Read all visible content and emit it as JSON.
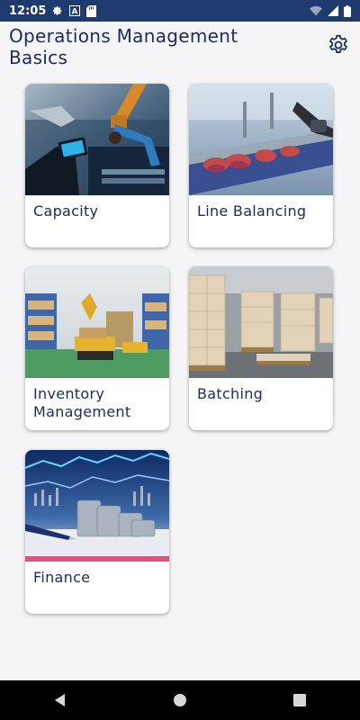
{
  "status_bar": {
    "time": "12:05",
    "icons_left": [
      "gear-icon",
      "a-box-icon",
      "sd-card-icon"
    ],
    "icons_right": [
      "wifi-icon",
      "signal-icon",
      "battery-icon"
    ],
    "background": "#1e3a6e"
  },
  "app_bar": {
    "title": "Operations Management Basics",
    "settings_icon": "gear-icon"
  },
  "cards": [
    {
      "label": "Capacity",
      "image": "factory-robot-arm-tablet-photo"
    },
    {
      "label": "Line Balancing",
      "image": "conveyor-belt-production-photo"
    },
    {
      "label": "Inventory Management",
      "image": "warehouse-agv-robot-photo"
    },
    {
      "label": "Batching",
      "image": "warehouse-boxes-pallets-photo"
    },
    {
      "label": "Finance",
      "image": "coins-pen-stock-chart-photo"
    }
  ],
  "nav_bar": {
    "buttons": [
      "back-icon",
      "home-icon",
      "recents-icon"
    ]
  },
  "colors": {
    "title_text": "#1d2b57",
    "background": "#f5f5f7",
    "card": "#ffffff"
  }
}
